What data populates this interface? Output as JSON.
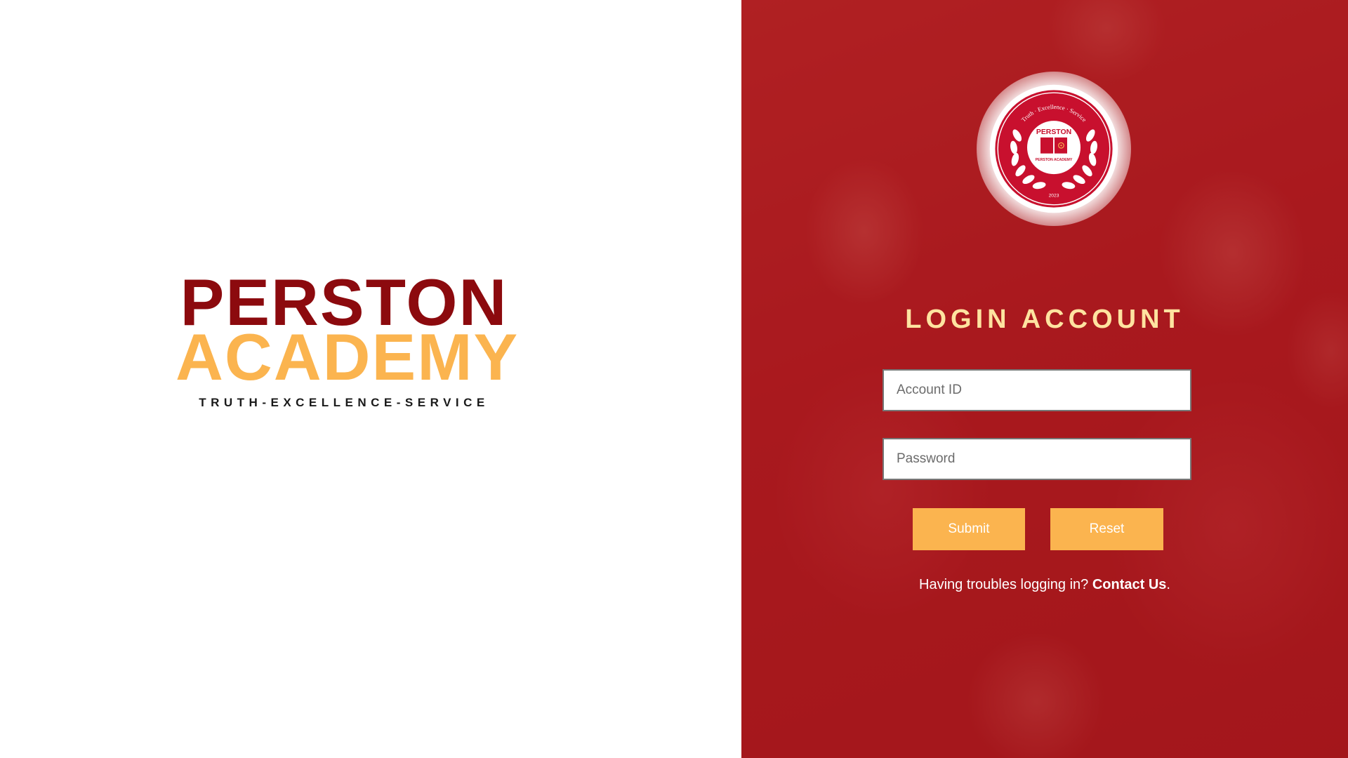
{
  "brand": {
    "line1": "PERSTON",
    "line2": "ACADEMY",
    "tagline": "TRUTH-EXCELLENCE-SERVICE"
  },
  "logo": {
    "arc_text": "Truth · Excellence · Service",
    "name": "PERSTON",
    "sub_name": "PERSTON ACADEMY",
    "year": "2023"
  },
  "login": {
    "title": "LOGIN ACCOUNT",
    "account_id_placeholder": "Account ID",
    "account_id_value": "",
    "password_placeholder": "Password",
    "password_value": "",
    "submit_label": "Submit",
    "reset_label": "Reset",
    "help_text": "Having troubles logging in?",
    "help_link": "Contact Us",
    "help_suffix": "."
  },
  "colors": {
    "brand_red": "#8c0a0e",
    "brand_gold": "#fbb44f",
    "title_cream": "#ffe3a0",
    "panel_red": "#b3282c"
  }
}
